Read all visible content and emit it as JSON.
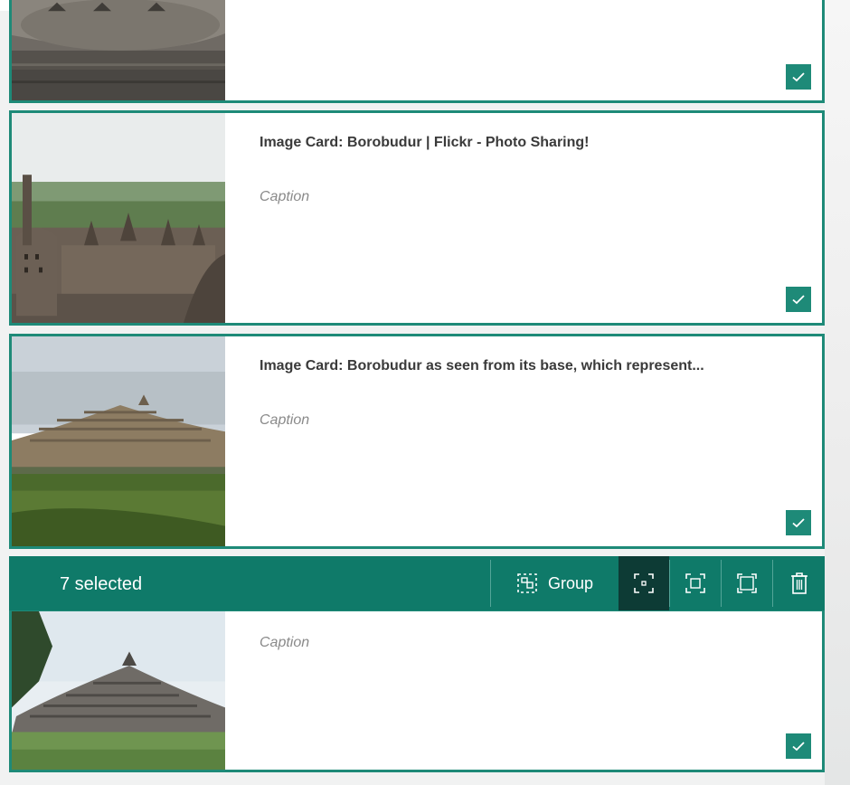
{
  "cards": [
    {
      "title": "",
      "caption": "",
      "checked": true
    },
    {
      "title": "Image Card: Borobudur | Flickr - Photo Sharing!",
      "caption": "Caption",
      "checked": true
    },
    {
      "title": "Image Card: Borobudur as seen from its base, which represent...",
      "caption": "Caption",
      "checked": true
    },
    {
      "title": "",
      "caption": "Caption",
      "checked": true
    }
  ],
  "selection_bar": {
    "count_label": "7 selected",
    "group_label": "Group",
    "tools": [
      "group-icon",
      "fit-small-icon",
      "fit-medium-icon",
      "fit-large-icon",
      "delete-icon"
    ]
  },
  "colors": {
    "accent": "#1e8a78",
    "bar": "#0f7a69",
    "active_tool": "#0d3b35"
  }
}
